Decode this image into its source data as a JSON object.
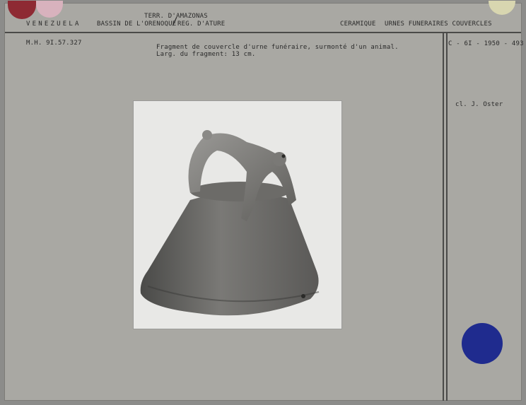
{
  "header": {
    "country": "VENEZUELA",
    "basin": "BASSIN DE L'ORENOQUE",
    "territory": "TERR. D'AMAZONAS",
    "region": "REG. D'ATURE",
    "ceramic": "CERAMIQUE",
    "category": "URNES FUNERAIRES  COUVERCLES"
  },
  "record": {
    "inventory": "M.H. 9I.57.327",
    "description_line1": "Fragment de couvercle d'urne funéraire, surmonté d'un animal.",
    "description_line2": "Larg. du fragment: 13 cm.",
    "reference": "C - 6I - 1950 - 493",
    "photo_credit": "cl. J. Oster"
  },
  "colors": {
    "card": "#a9a8a3",
    "red_dot": "#8e2a33",
    "pink_dot": "#d8b2bd",
    "yellow_dot": "#d8d6b0",
    "blue_dot": "#1f2b8e"
  }
}
